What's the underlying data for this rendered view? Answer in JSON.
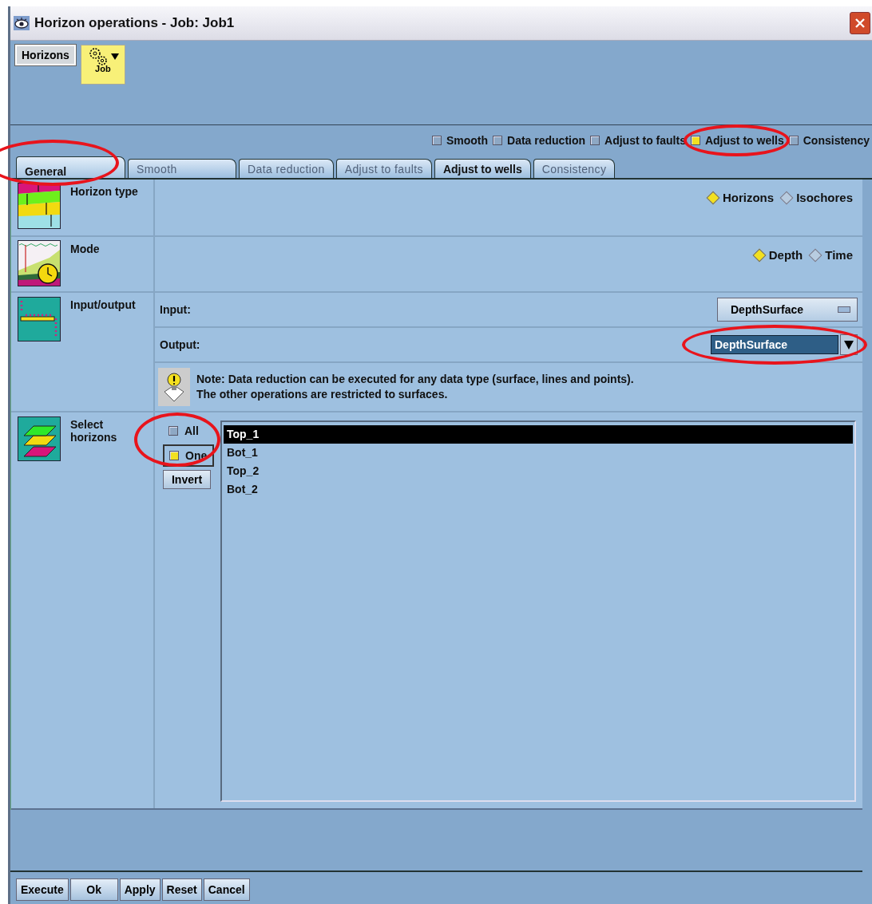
{
  "window": {
    "title": "Horizon operations - Job: Job1"
  },
  "toolbar": {
    "horizons_button": "Horizons",
    "job_button": "Job"
  },
  "operations": [
    {
      "label": "Smooth",
      "checked": false
    },
    {
      "label": "Data reduction",
      "checked": false
    },
    {
      "label": "Adjust to faults",
      "checked": false
    },
    {
      "label": "Adjust to wells",
      "checked": true
    },
    {
      "label": "Consistency",
      "checked": false
    }
  ],
  "tabs": [
    {
      "label": "General",
      "selected": true,
      "disabled": false
    },
    {
      "label": "Smooth",
      "selected": false,
      "disabled": true
    },
    {
      "label": "Data reduction",
      "selected": false,
      "disabled": true
    },
    {
      "label": "Adjust to faults",
      "selected": false,
      "disabled": true
    },
    {
      "label": "Adjust to wells",
      "selected": false,
      "disabled": false
    },
    {
      "label": "Consistency",
      "selected": false,
      "disabled": true
    }
  ],
  "horizon_type": {
    "label": "Horizon type",
    "options": [
      {
        "label": "Horizons",
        "selected": true
      },
      {
        "label": "Isochores",
        "selected": false
      }
    ]
  },
  "mode": {
    "label": "Mode",
    "options": [
      {
        "label": "Depth",
        "selected": true
      },
      {
        "label": "Time",
        "selected": false
      }
    ]
  },
  "input_output": {
    "label": "Input/output",
    "input_label": "Input:",
    "input_value": "DepthSurface",
    "output_label": "Output:",
    "output_value": "DepthSurface",
    "note": [
      "Note:  Data reduction can be executed for any data type (surface, lines and points).",
      "The other operations are restricted to surfaces."
    ]
  },
  "select_horizons": {
    "label": "Select horizons",
    "modes": [
      {
        "label": "All",
        "selected": false
      },
      {
        "label": "One",
        "selected": true
      }
    ],
    "invert_button": "Invert",
    "items": [
      {
        "label": "Top_1",
        "selected": true
      },
      {
        "label": "Bot_1",
        "selected": false
      },
      {
        "label": "Top_2",
        "selected": false
      },
      {
        "label": "Bot_2",
        "selected": false
      }
    ]
  },
  "buttons": [
    "Execute",
    "Ok",
    "Apply",
    "Reset",
    "Cancel"
  ],
  "annotations": [
    {
      "kind": "ellipse",
      "color": "#e8141c"
    },
    {
      "kind": "ellipse",
      "color": "#e8141c"
    },
    {
      "kind": "ellipse",
      "color": "#e8141c"
    },
    {
      "kind": "ellipse",
      "color": "#e8141c"
    }
  ]
}
